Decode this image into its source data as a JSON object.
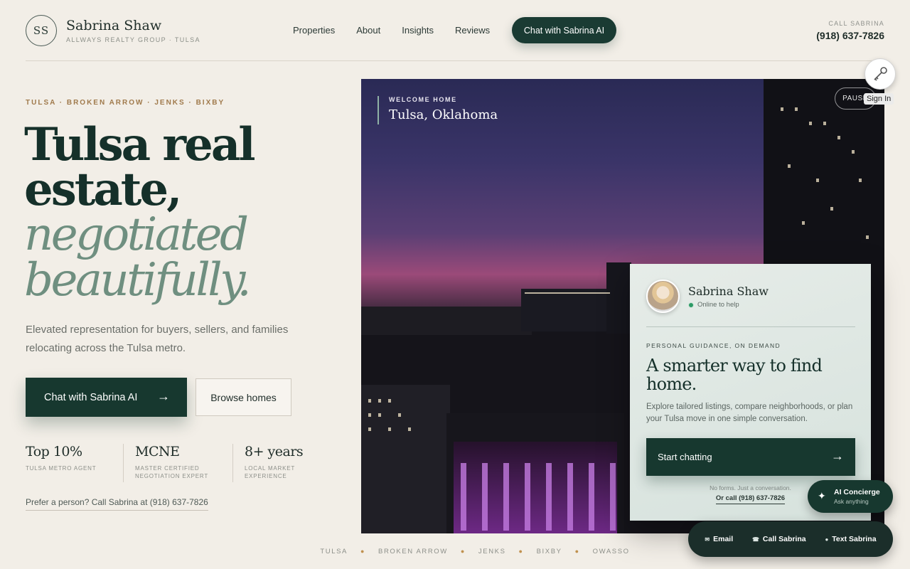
{
  "brand": {
    "initials": "SS",
    "name": "Sabrina Shaw",
    "subtitle": "ALLWAYS REALTY GROUP · TULSA"
  },
  "nav": {
    "items": [
      "Properties",
      "About",
      "Insights",
      "Reviews"
    ],
    "cta": "Chat with Sabrina AI"
  },
  "call": {
    "label": "CALL SABRINA",
    "phone": "(918) 637-7826"
  },
  "hero": {
    "eyebrow": "TULSA · BROKEN ARROW · JENKS · BIXBY",
    "headline_line1": "Tulsa real",
    "headline_line2": "estate,",
    "headline_accent1": "negotiated",
    "headline_accent2": "beautifully.",
    "lede": "Elevated representation for buyers, sellers, and families relocating across the Tulsa metro.",
    "primary_button": "Chat with Sabrina AI",
    "primary_arrow": "→",
    "secondary_button": "Browse homes",
    "stats": [
      {
        "value": "Top 10%",
        "label": "TULSA METRO AGENT"
      },
      {
        "value": "MCNE",
        "label": "MASTER CERTIFIED NEGOTIATION EXPERT"
      },
      {
        "value": "8+ years",
        "label": "LOCAL MARKET EXPERIENCE"
      }
    ],
    "prefer_link": "Prefer a person? Call Sabrina at (918) 637-7826"
  },
  "media": {
    "welcome_eyebrow": "WELCOME HOME",
    "welcome_city": "Tulsa, Oklahoma",
    "pause": "PAUSE"
  },
  "chat_card": {
    "agent_name": "Sabrina Shaw",
    "status": "Online to help",
    "eyebrow": "PERSONAL GUIDANCE, ON DEMAND",
    "title": "A smarter way to find home.",
    "body": "Explore tailored listings, compare neighborhoods, or plan your Tulsa move in one simple conversation.",
    "button": "Start chatting",
    "button_arrow": "→",
    "note": "No forms. Just a conversation.",
    "call_link": "Or call (918) 637-7826"
  },
  "signin": {
    "label": "Sign In"
  },
  "concierge": {
    "title": "AI Concierge",
    "subtitle": "Ask anything",
    "icon": "✦"
  },
  "contact_bar": {
    "email": "Email",
    "call": "Call Sabrina",
    "text": "Text Sabrina"
  },
  "cities": [
    "TULSA",
    "BROKEN ARROW",
    "JENKS",
    "BIXBY",
    "OWASSO"
  ],
  "colors": {
    "primary": "#17382f",
    "accent_sage": "#6f8f80",
    "eyebrow_gold": "#a07a4c",
    "background": "#f2eee7"
  }
}
